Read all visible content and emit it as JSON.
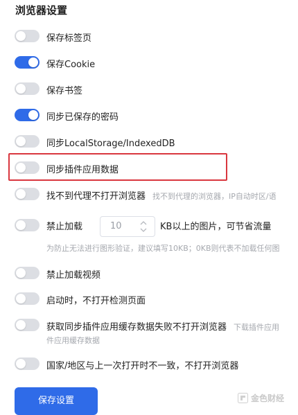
{
  "section_title": "浏览器设置",
  "accent_color": "#2f6be8",
  "highlight_color": "#d9363e",
  "settings": [
    {
      "label": "保存标签页",
      "on": false
    },
    {
      "label": "保存Cookie",
      "on": true
    },
    {
      "label": "保存书签",
      "on": false
    },
    {
      "label": "同步已保存的密码",
      "on": true
    },
    {
      "label": "同步LocalStorage/IndexedDB",
      "on": false
    },
    {
      "label": "同步插件应用数据",
      "on": false
    },
    {
      "label": "找不到代理不打开浏览器",
      "hint": "找不到代理的浏览器，IP自动时区/语",
      "on": false
    },
    {
      "label": "禁止加载",
      "after_label": "KB以上的图片，可节省流量",
      "sub": "为防止无法进行图形验证，建议填写10KB；0KB则代表不加载任何图",
      "on": false
    },
    {
      "label": "禁止加载视频",
      "on": false
    },
    {
      "label": "启动时，不打开检测页面",
      "on": false
    },
    {
      "label": "获取同步插件应用缓存数据失败不打开浏览器",
      "hint": "下载插件应用",
      "sub": "件应用缓存数据",
      "on": false
    },
    {
      "label": "国家/地区与上一次打开时不一致，不打开浏览器",
      "on": false
    }
  ],
  "image_limit": {
    "value": "10"
  },
  "save_button": "保存设置",
  "watermark": "金色财经"
}
